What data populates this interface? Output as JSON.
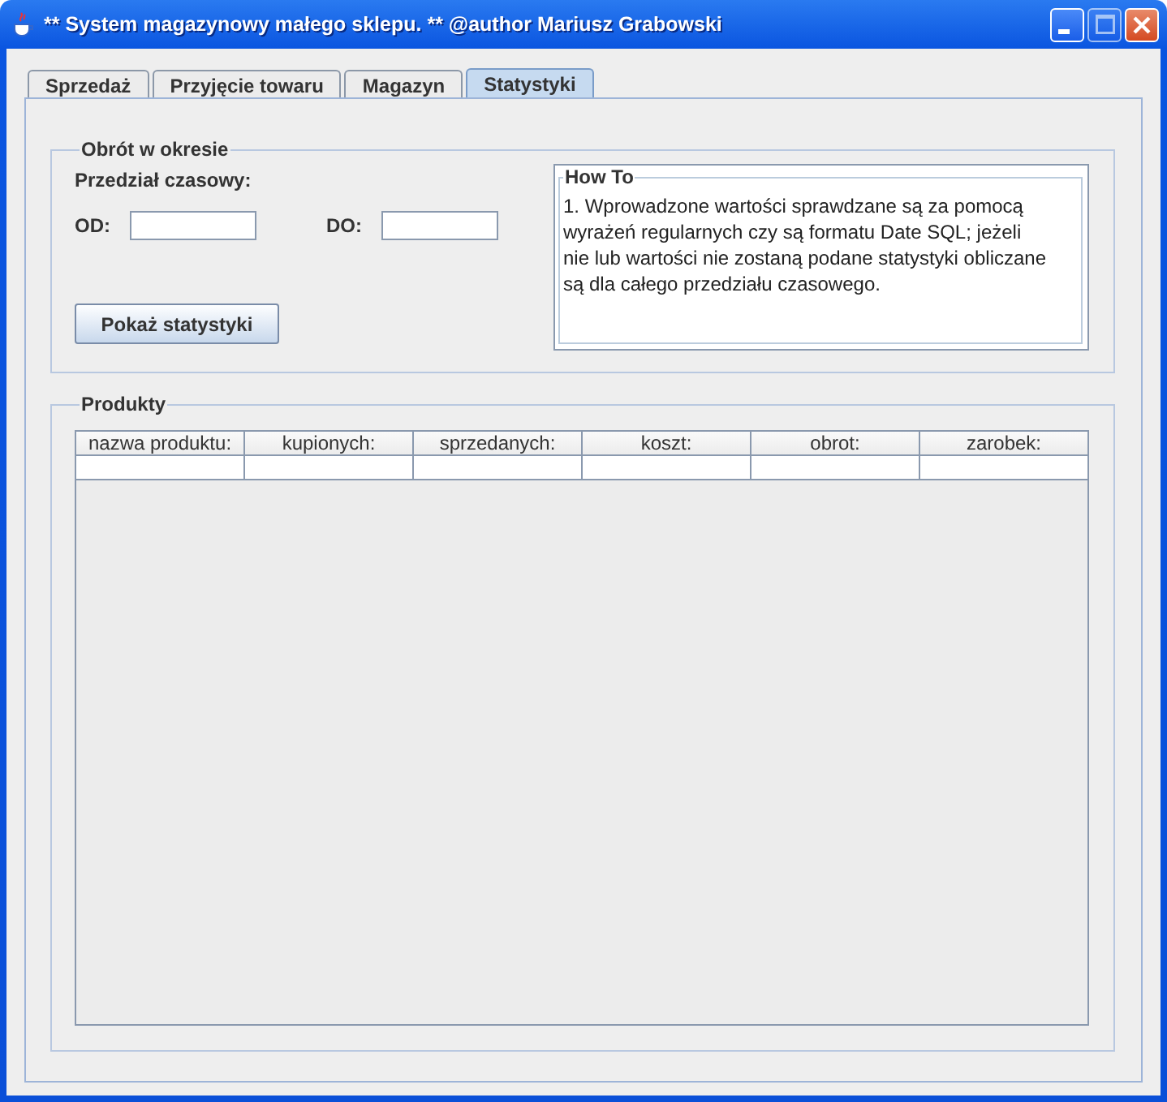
{
  "window": {
    "title": "** System magazynowy małego sklepu. ** @author Mariusz Grabowski"
  },
  "tabs": [
    {
      "label": "Sprzedaż",
      "selected": false
    },
    {
      "label": "Przyjęcie towaru",
      "selected": false
    },
    {
      "label": "Magazyn",
      "selected": false
    },
    {
      "label": "Statystyki",
      "selected": true
    }
  ],
  "period": {
    "title": "Obrót w okresie",
    "range_label": "Przedział czasowy:",
    "from_label": "OD:",
    "to_label": "DO:",
    "button": "Pokaż statystyki",
    "howto": {
      "title": "How To",
      "lines": [
        "1. Wprowadzone wartości sprawdzane są za pomocą",
        "wyrażeń regularnych czy są formatu Date SQL; jeżeli",
        "nie lub wartości nie zostaną podane statystyki obliczane",
        "są dla całego przedziału czasowego."
      ]
    }
  },
  "products": {
    "title": "Produkty",
    "columns": [
      "nazwa produktu:",
      "kupionych:",
      "sprzedanych:",
      "koszt:",
      "obrot:",
      "zarobek:"
    ]
  }
}
